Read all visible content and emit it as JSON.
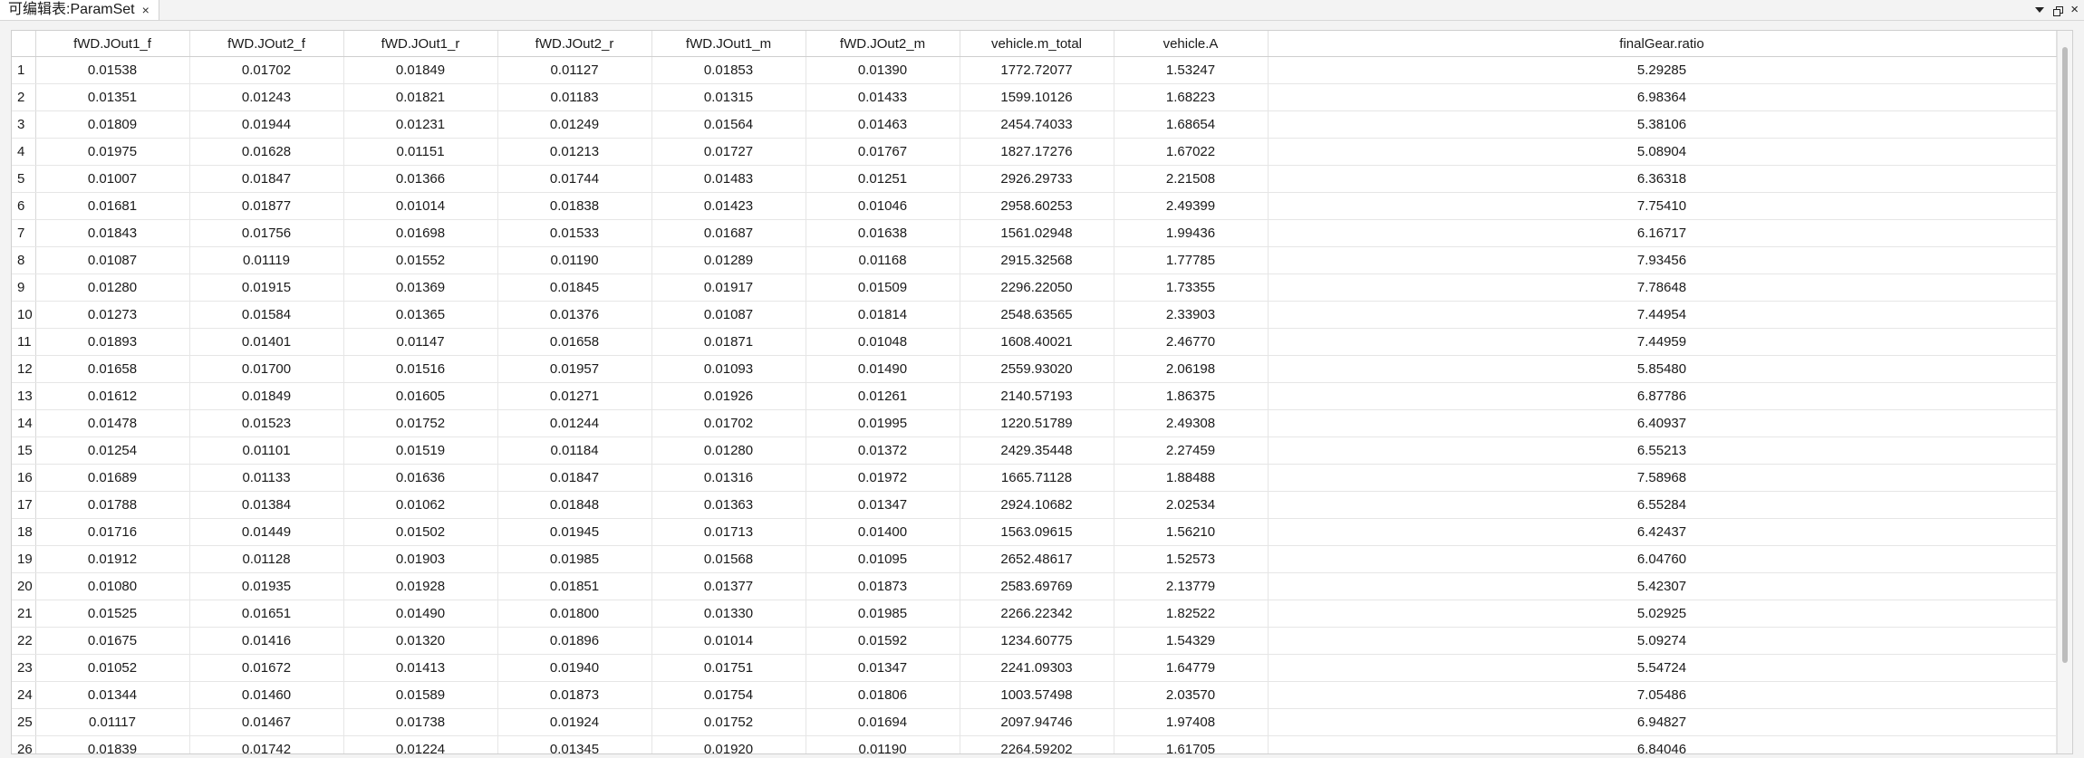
{
  "tab": {
    "title": "可编辑表:ParamSet",
    "close_glyph": "×"
  },
  "window_controls": {
    "dropdown_icon": "chevron-down-icon",
    "restore_icon": "restore-icon",
    "close_glyph": "×"
  },
  "table": {
    "columns": [
      "fWD.JOut1_f",
      "fWD.JOut2_f",
      "fWD.JOut1_r",
      "fWD.JOut2_r",
      "fWD.JOut1_m",
      "fWD.JOut2_m",
      "vehicle.m_total",
      "vehicle.A",
      "finalGear.ratio"
    ],
    "rows": [
      {
        "n": "1",
        "cells": [
          "0.01538",
          "0.01702",
          "0.01849",
          "0.01127",
          "0.01853",
          "0.01390",
          "1772.72077",
          "1.53247",
          "5.29285"
        ]
      },
      {
        "n": "2",
        "cells": [
          "0.01351",
          "0.01243",
          "0.01821",
          "0.01183",
          "0.01315",
          "0.01433",
          "1599.10126",
          "1.68223",
          "6.98364"
        ]
      },
      {
        "n": "3",
        "cells": [
          "0.01809",
          "0.01944",
          "0.01231",
          "0.01249",
          "0.01564",
          "0.01463",
          "2454.74033",
          "1.68654",
          "5.38106"
        ]
      },
      {
        "n": "4",
        "cells": [
          "0.01975",
          "0.01628",
          "0.01151",
          "0.01213",
          "0.01727",
          "0.01767",
          "1827.17276",
          "1.67022",
          "5.08904"
        ]
      },
      {
        "n": "5",
        "cells": [
          "0.01007",
          "0.01847",
          "0.01366",
          "0.01744",
          "0.01483",
          "0.01251",
          "2926.29733",
          "2.21508",
          "6.36318"
        ]
      },
      {
        "n": "6",
        "cells": [
          "0.01681",
          "0.01877",
          "0.01014",
          "0.01838",
          "0.01423",
          "0.01046",
          "2958.60253",
          "2.49399",
          "7.75410"
        ]
      },
      {
        "n": "7",
        "cells": [
          "0.01843",
          "0.01756",
          "0.01698",
          "0.01533",
          "0.01687",
          "0.01638",
          "1561.02948",
          "1.99436",
          "6.16717"
        ]
      },
      {
        "n": "8",
        "cells": [
          "0.01087",
          "0.01119",
          "0.01552",
          "0.01190",
          "0.01289",
          "0.01168",
          "2915.32568",
          "1.77785",
          "7.93456"
        ]
      },
      {
        "n": "9",
        "cells": [
          "0.01280",
          "0.01915",
          "0.01369",
          "0.01845",
          "0.01917",
          "0.01509",
          "2296.22050",
          "1.73355",
          "7.78648"
        ]
      },
      {
        "n": "10",
        "cells": [
          "0.01273",
          "0.01584",
          "0.01365",
          "0.01376",
          "0.01087",
          "0.01814",
          "2548.63565",
          "2.33903",
          "7.44954"
        ]
      },
      {
        "n": "11",
        "cells": [
          "0.01893",
          "0.01401",
          "0.01147",
          "0.01658",
          "0.01871",
          "0.01048",
          "1608.40021",
          "2.46770",
          "7.44959"
        ]
      },
      {
        "n": "12",
        "cells": [
          "0.01658",
          "0.01700",
          "0.01516",
          "0.01957",
          "0.01093",
          "0.01490",
          "2559.93020",
          "2.06198",
          "5.85480"
        ]
      },
      {
        "n": "13",
        "cells": [
          "0.01612",
          "0.01849",
          "0.01605",
          "0.01271",
          "0.01926",
          "0.01261",
          "2140.57193",
          "1.86375",
          "6.87786"
        ]
      },
      {
        "n": "14",
        "cells": [
          "0.01478",
          "0.01523",
          "0.01752",
          "0.01244",
          "0.01702",
          "0.01995",
          "1220.51789",
          "2.49308",
          "6.40937"
        ]
      },
      {
        "n": "15",
        "cells": [
          "0.01254",
          "0.01101",
          "0.01519",
          "0.01184",
          "0.01280",
          "0.01372",
          "2429.35448",
          "2.27459",
          "6.55213"
        ]
      },
      {
        "n": "16",
        "cells": [
          "0.01689",
          "0.01133",
          "0.01636",
          "0.01847",
          "0.01316",
          "0.01972",
          "1665.71128",
          "1.88488",
          "7.58968"
        ]
      },
      {
        "n": "17",
        "cells": [
          "0.01788",
          "0.01384",
          "0.01062",
          "0.01848",
          "0.01363",
          "0.01347",
          "2924.10682",
          "2.02534",
          "6.55284"
        ]
      },
      {
        "n": "18",
        "cells": [
          "0.01716",
          "0.01449",
          "0.01502",
          "0.01945",
          "0.01713",
          "0.01400",
          "1563.09615",
          "1.56210",
          "6.42437"
        ]
      },
      {
        "n": "19",
        "cells": [
          "0.01912",
          "0.01128",
          "0.01903",
          "0.01985",
          "0.01568",
          "0.01095",
          "2652.48617",
          "1.52573",
          "6.04760"
        ]
      },
      {
        "n": "20",
        "cells": [
          "0.01080",
          "0.01935",
          "0.01928",
          "0.01851",
          "0.01377",
          "0.01873",
          "2583.69769",
          "2.13779",
          "5.42307"
        ]
      },
      {
        "n": "21",
        "cells": [
          "0.01525",
          "0.01651",
          "0.01490",
          "0.01800",
          "0.01330",
          "0.01985",
          "2266.22342",
          "1.82522",
          "5.02925"
        ]
      },
      {
        "n": "22",
        "cells": [
          "0.01675",
          "0.01416",
          "0.01320",
          "0.01896",
          "0.01014",
          "0.01592",
          "1234.60775",
          "1.54329",
          "5.09274"
        ]
      },
      {
        "n": "23",
        "cells": [
          "0.01052",
          "0.01672",
          "0.01413",
          "0.01940",
          "0.01751",
          "0.01347",
          "2241.09303",
          "1.64779",
          "5.54724"
        ]
      },
      {
        "n": "24",
        "cells": [
          "0.01344",
          "0.01460",
          "0.01589",
          "0.01873",
          "0.01754",
          "0.01806",
          "1003.57498",
          "2.03570",
          "7.05486"
        ]
      },
      {
        "n": "25",
        "cells": [
          "0.01117",
          "0.01467",
          "0.01738",
          "0.01924",
          "0.01752",
          "0.01694",
          "2097.94746",
          "1.97408",
          "6.94827"
        ]
      },
      {
        "n": "26",
        "cells": [
          "0.01839",
          "0.01742",
          "0.01224",
          "0.01345",
          "0.01920",
          "0.01190",
          "2264.59202",
          "1.61705",
          "6.84046"
        ]
      }
    ]
  },
  "colors": {
    "background": "#f3f3f3",
    "grid_background": "#ffffff",
    "grid_line": "#e6e6e6",
    "scroll_thumb": "#bdbdbd"
  }
}
